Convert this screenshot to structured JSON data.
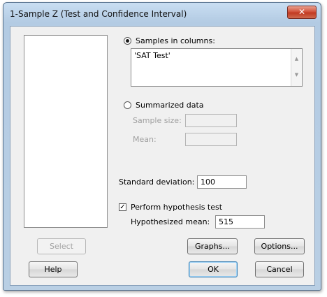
{
  "window": {
    "title": "1-Sample Z (Test and Confidence Interval)",
    "close_glyph": "✕",
    "close_icon": "close-icon"
  },
  "samples_in_columns": {
    "label": "Samples in columns:",
    "selected": true,
    "value": "'SAT Test'"
  },
  "summarized_data": {
    "label": "Summarized data",
    "selected": false,
    "sample_size_label": "Sample size:",
    "sample_size_value": "",
    "mean_label": "Mean:",
    "mean_value": ""
  },
  "standard_deviation": {
    "label": "Standard deviation:",
    "value": "100"
  },
  "hypothesis_test": {
    "label": "Perform hypothesis test",
    "checked": true,
    "check_glyph": "✓",
    "mean_label": "Hypothesized mean:",
    "mean_value": "515"
  },
  "buttons": {
    "select": "Select",
    "graphs": "Graphs...",
    "options": "Options...",
    "help": "Help",
    "ok": "OK",
    "cancel": "Cancel"
  },
  "scroll_icons": {
    "up": "▲",
    "down": "▼"
  }
}
